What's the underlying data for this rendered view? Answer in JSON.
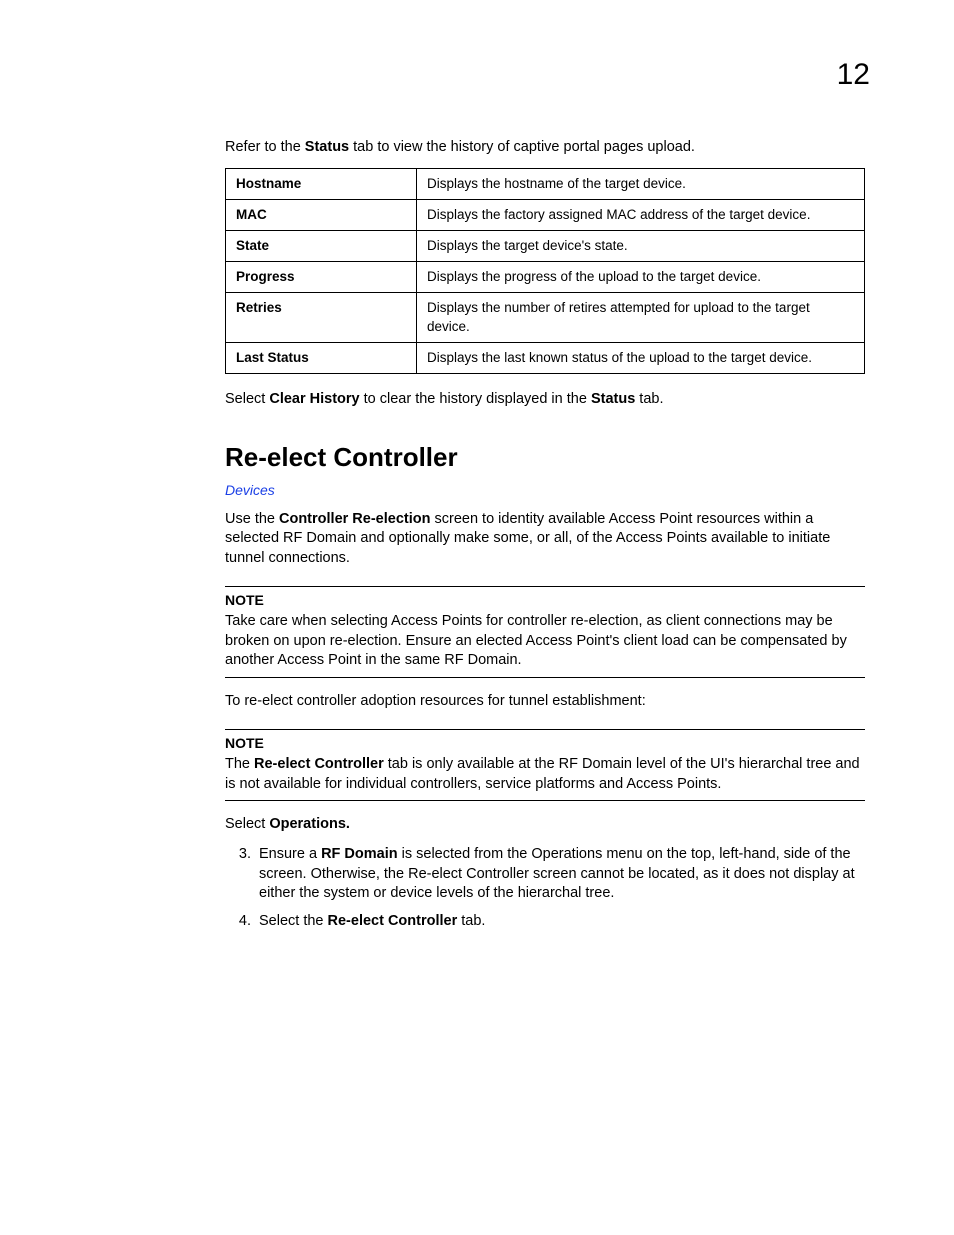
{
  "pageNumber": "12",
  "intro": {
    "pre": "Refer to the ",
    "bold": "Status",
    "post": " tab to view the history of captive portal pages upload."
  },
  "table": [
    {
      "key": "Hostname",
      "val": "Displays the hostname of the target device."
    },
    {
      "key": "MAC",
      "val": "Displays the factory assigned MAC address of the target device."
    },
    {
      "key": "State",
      "val": "Displays the target device's state."
    },
    {
      "key": "Progress",
      "val": "Displays the progress of the upload to the target device."
    },
    {
      "key": "Retries",
      "val": "Displays the number of retires attempted for upload to the target device."
    },
    {
      "key": "Last Status",
      "val": "Displays the last known status of the upload to the target device."
    }
  ],
  "clearHistory": {
    "pre": "Select ",
    "bold1": "Clear History",
    "mid": " to clear the history displayed in the ",
    "bold2": "Status",
    "post": " tab."
  },
  "sectionTitle": "Re-elect Controller",
  "devicesLink": "Devices",
  "sectionPara": {
    "pre": "Use the ",
    "bold": "Controller Re-election",
    "post": " screen to identity available Access Point resources within a selected RF Domain and optionally make some, or all, of the Access Points available to initiate tunnel connections."
  },
  "note1": {
    "label": "NOTE",
    "text": "Take care when selecting Access Points for controller re-election, as client connections may be broken on upon re-election. Ensure an elected Access Point's client load can be compensated by another Access Point in the same RF Domain."
  },
  "midPara": "To re-elect controller adoption resources for tunnel establishment:",
  "note2": {
    "label": "NOTE",
    "pre": "The ",
    "bold": "Re-elect Controller",
    "post": " tab is only available at the RF Domain level of the UI's hierarchal tree and is not available for individual controllers, service platforms and Access Points."
  },
  "selectOps": {
    "pre": "Select ",
    "bold": "Operations."
  },
  "step3": {
    "pre": "Ensure a ",
    "bold": "RF Domain",
    "post": " is selected from the Operations menu on the top, left-hand, side of the screen. Otherwise, the Re-elect Controller screen cannot be located, as it does not display at either the system or device levels of the hierarchal tree."
  },
  "step4": {
    "pre": "Select the ",
    "bold": "Re-elect Controller",
    "post": " tab."
  }
}
